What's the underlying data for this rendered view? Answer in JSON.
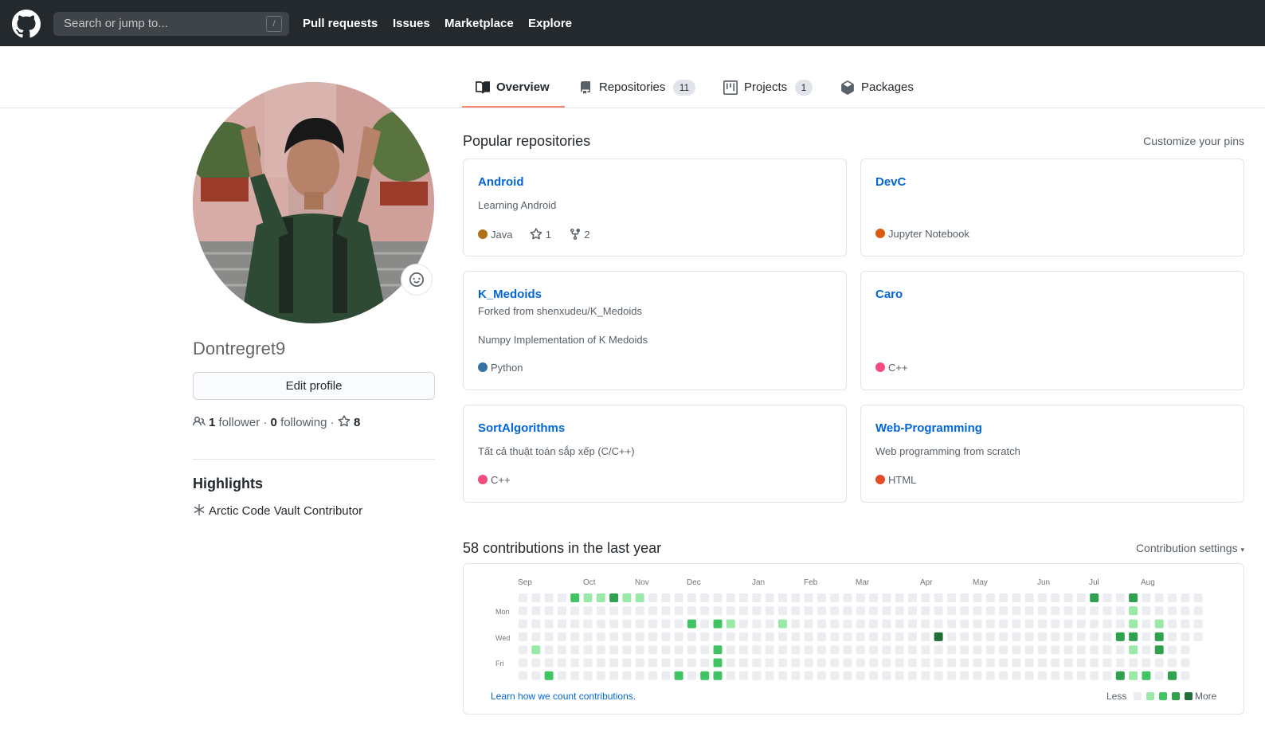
{
  "header": {
    "search_placeholder": "Search or jump to...",
    "search_shortcut": "/",
    "nav": [
      "Pull requests",
      "Issues",
      "Marketplace",
      "Explore"
    ]
  },
  "tabs": [
    {
      "label": "Overview",
      "icon": "book-icon",
      "count": null,
      "selected": true
    },
    {
      "label": "Repositories",
      "icon": "repo-icon",
      "count": "11",
      "selected": false
    },
    {
      "label": "Projects",
      "icon": "project-icon",
      "count": "1",
      "selected": false
    },
    {
      "label": "Packages",
      "icon": "package-icon",
      "count": null,
      "selected": false
    }
  ],
  "profile": {
    "username": "Dontregret9",
    "edit_label": "Edit profile",
    "followers": "1",
    "followers_label": "follower",
    "following": "0",
    "following_label": "following",
    "stars": "8",
    "highlights_title": "Highlights",
    "highlight_item": "Arctic Code Vault Contributor"
  },
  "popular": {
    "title": "Popular repositories",
    "customize": "Customize your pins",
    "repos": [
      {
        "name": "Android",
        "forked_from": "",
        "description": "Learning Android",
        "language": "Java",
        "lang_color": "#b07219",
        "stars": "1",
        "forks": "2"
      },
      {
        "name": "DevC",
        "forked_from": "",
        "description": "",
        "language": "Jupyter Notebook",
        "lang_color": "#DA5B0B",
        "stars": "",
        "forks": ""
      },
      {
        "name": "K_Medoids",
        "forked_from": "Forked from shenxudeu/K_Medoids",
        "description": "Numpy Implementation of K Medoids",
        "language": "Python",
        "lang_color": "#3572A5",
        "stars": "",
        "forks": ""
      },
      {
        "name": "Caro",
        "forked_from": "",
        "description": "",
        "language": "C++",
        "lang_color": "#f34b7d",
        "stars": "",
        "forks": ""
      },
      {
        "name": "SortAlgorithms",
        "forked_from": "",
        "description": "Tất cả thuật toán sắp xếp (C/C++)",
        "language": "C++",
        "lang_color": "#f34b7d",
        "stars": "",
        "forks": ""
      },
      {
        "name": "Web-Programming",
        "forked_from": "",
        "description": "Web programming from scratch",
        "language": "HTML",
        "lang_color": "#e34c26",
        "stars": "",
        "forks": ""
      }
    ]
  },
  "contributions": {
    "title": "58 contributions in the last year",
    "settings": "Contribution settings",
    "months": [
      "Sep",
      "Oct",
      "Nov",
      "Dec",
      "Jan",
      "Feb",
      "Mar",
      "Apr",
      "May",
      "Jun",
      "Jul",
      "Aug"
    ],
    "weekdays": [
      "Mon",
      "Wed",
      "Fri"
    ],
    "learn": "Learn how we count contributions.",
    "less": "Less",
    "more": "More",
    "colors": [
      "#ebedf0",
      "#9be9a8",
      "#40c463",
      "#30a14e",
      "#216e39"
    ],
    "cells": [
      [
        4,
        0,
        2
      ],
      [
        5,
        0,
        1
      ],
      [
        6,
        0,
        1
      ],
      [
        7,
        0,
        3
      ],
      [
        8,
        0,
        1
      ],
      [
        9,
        0,
        1
      ],
      [
        1,
        4,
        1
      ],
      [
        2,
        6,
        2
      ],
      [
        13,
        2,
        2
      ],
      [
        12,
        6,
        2
      ],
      [
        14,
        6,
        2
      ],
      [
        15,
        5,
        2
      ],
      [
        15,
        4,
        2
      ],
      [
        15,
        2,
        2
      ],
      [
        15,
        6,
        2
      ],
      [
        16,
        2,
        1
      ],
      [
        20,
        2,
        1
      ],
      [
        32,
        3,
        4
      ],
      [
        44,
        0,
        3
      ],
      [
        46,
        3,
        3
      ],
      [
        47,
        0,
        3
      ],
      [
        47,
        1,
        1
      ],
      [
        47,
        2,
        1
      ],
      [
        47,
        3,
        3
      ],
      [
        47,
        4,
        1
      ],
      [
        47,
        6,
        1
      ],
      [
        48,
        6,
        1
      ],
      [
        49,
        2,
        1
      ],
      [
        49,
        3,
        3
      ],
      [
        49,
        4,
        3
      ],
      [
        48,
        6,
        2
      ],
      [
        46,
        6,
        3
      ],
      [
        50,
        6,
        3
      ]
    ]
  }
}
